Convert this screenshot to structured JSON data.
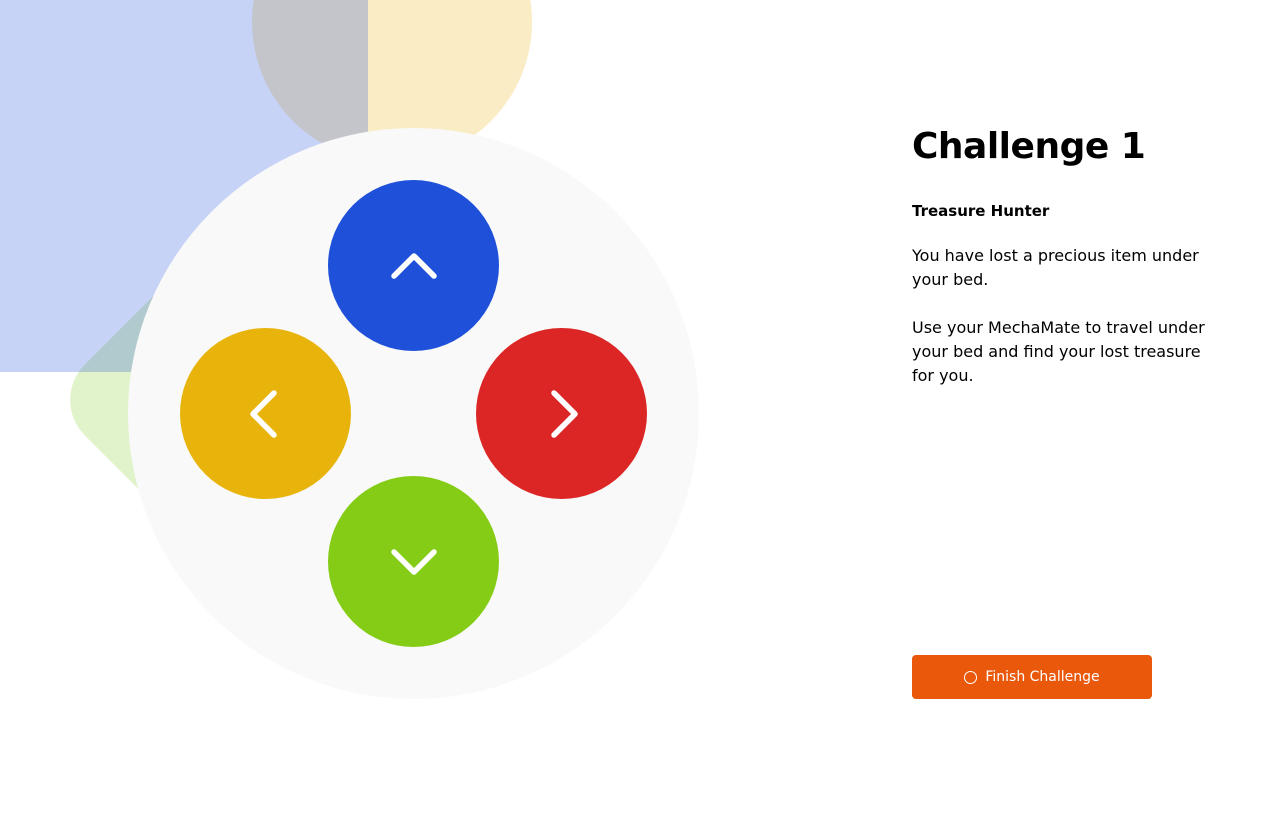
{
  "colors": {
    "up": "#1e50da",
    "left": "#e8b40c",
    "right": "#dc2626",
    "down": "#84cc16",
    "accent": "#ea580c"
  },
  "controls": {
    "up_icon": "chevron-up-icon",
    "left_icon": "chevron-left-icon",
    "right_icon": "chevron-right-icon",
    "down_icon": "chevron-down-icon"
  },
  "challenge": {
    "title": "Challenge 1",
    "subtitle": "Treasure Hunter",
    "paragraphs": [
      "You have lost a precious item under your bed.",
      "Use your MechaMate to travel under your bed and find your lost treasure for you."
    ],
    "finish_label": "Finish Challenge",
    "finish_icon": "circle-icon"
  }
}
